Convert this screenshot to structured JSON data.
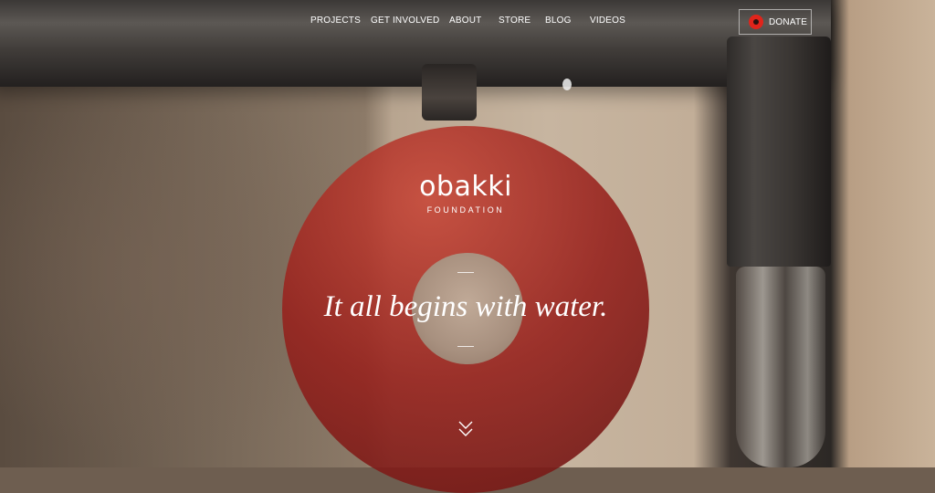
{
  "nav": {
    "items": [
      {
        "label": "PROJECTS"
      },
      {
        "label": "GET INVOLVED"
      },
      {
        "label": "ABOUT"
      },
      {
        "label": "STORE"
      },
      {
        "label": "BLOG"
      },
      {
        "label": "VIDEOS"
      }
    ],
    "donate": {
      "label": "DONATE",
      "icon": "donate-circle-icon"
    }
  },
  "logo": {
    "word": "obakki",
    "sub": "FOUNDATION"
  },
  "hero": {
    "tagline": "It all begins with water.",
    "scroll_icon": "double-chevron-down-icon"
  },
  "colors": {
    "accent": "#e0241b",
    "circle": "#9b2a24"
  }
}
